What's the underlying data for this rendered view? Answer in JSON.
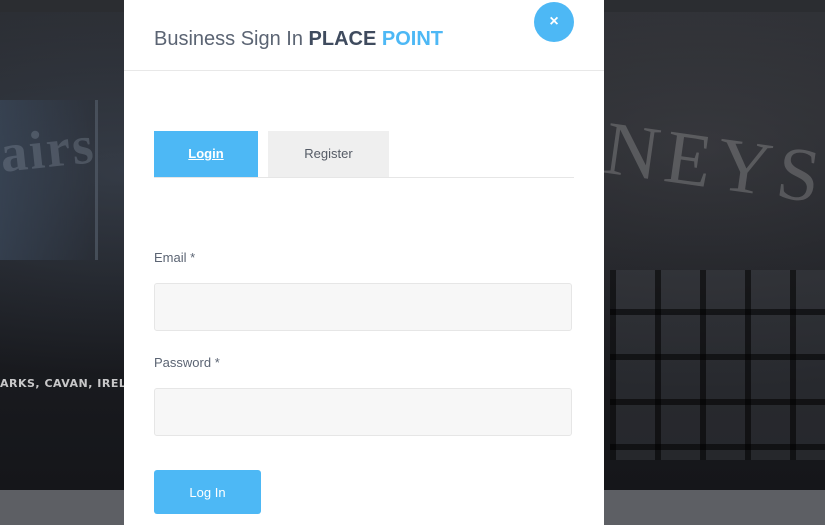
{
  "background": {
    "caption": "ARKS, CAVAN, IRELA",
    "sign_left": "airs",
    "sign_right": "NEYS"
  },
  "modal": {
    "title_prefix": "Business Sign In",
    "brand_part1": "PLACE",
    "brand_part2": "POINT",
    "close_glyph": "×",
    "close_icon": "close-icon"
  },
  "tabs": [
    {
      "label": "Login",
      "active": true
    },
    {
      "label": "Register",
      "active": false
    }
  ],
  "form": {
    "email": {
      "label": "Email",
      "required_mark": "*",
      "value": "",
      "placeholder": ""
    },
    "password": {
      "label": "Password",
      "required_mark": "*",
      "value": "",
      "placeholder": ""
    },
    "submit_label": "Log In"
  },
  "colors": {
    "accent": "#4db8f5",
    "brand_dark": "#3f4b5e",
    "tab_inactive_bg": "#efefef"
  }
}
